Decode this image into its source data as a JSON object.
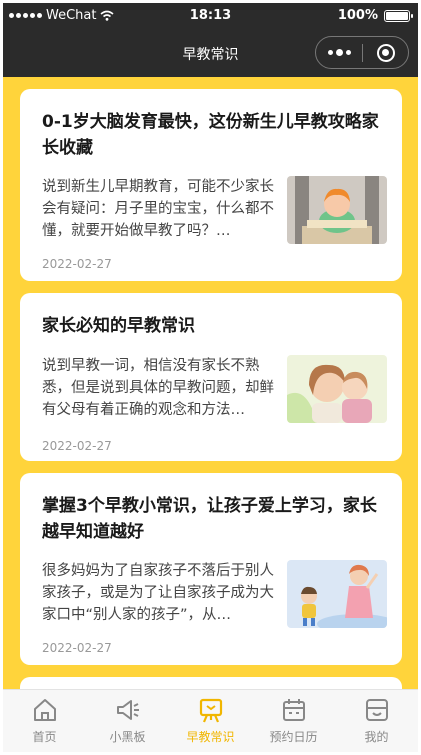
{
  "status_bar": {
    "carrier": "WeChat",
    "time": "18:13",
    "battery": "100%"
  },
  "nav": {
    "title": "早教常识"
  },
  "articles": [
    {
      "title": "0-1岁大脑发育最快，这份新生儿早教攻略家长收藏",
      "summary": "说到新生儿早期教育，可能不少家长会有疑问：月子里的宝宝，什么都不懂，就要开始做早教了吗？…",
      "date": "2022-02-27"
    },
    {
      "title": "家长必知的早教常识",
      "summary": "说到早教一词，相信没有家长不熟悉，但是说到具体的早教问题，却鲜有父母有着正确的观念和方法…",
      "date": "2022-02-27"
    },
    {
      "title": "掌握3个早教小常识，让孩子爱上学习，家长越早知道越好",
      "summary": "很多妈妈为了自家孩子不落后于别人家孩子，或是为了让自家孩子成为大家口中“别人家的孩子”，从…",
      "date": "2022-02-27"
    }
  ],
  "tabs": [
    {
      "label": "首页",
      "icon": "home-icon",
      "active": false
    },
    {
      "label": "小黑板",
      "icon": "megaphone-icon",
      "active": false
    },
    {
      "label": "早教常识",
      "icon": "board-icon",
      "active": true
    },
    {
      "label": "预约日历",
      "icon": "calendar-icon",
      "active": false
    },
    {
      "label": "我的",
      "icon": "profile-icon",
      "active": false
    }
  ],
  "colors": {
    "accent": "#f1b600",
    "background": "#ffd43b",
    "header": "#2b2b2b"
  }
}
